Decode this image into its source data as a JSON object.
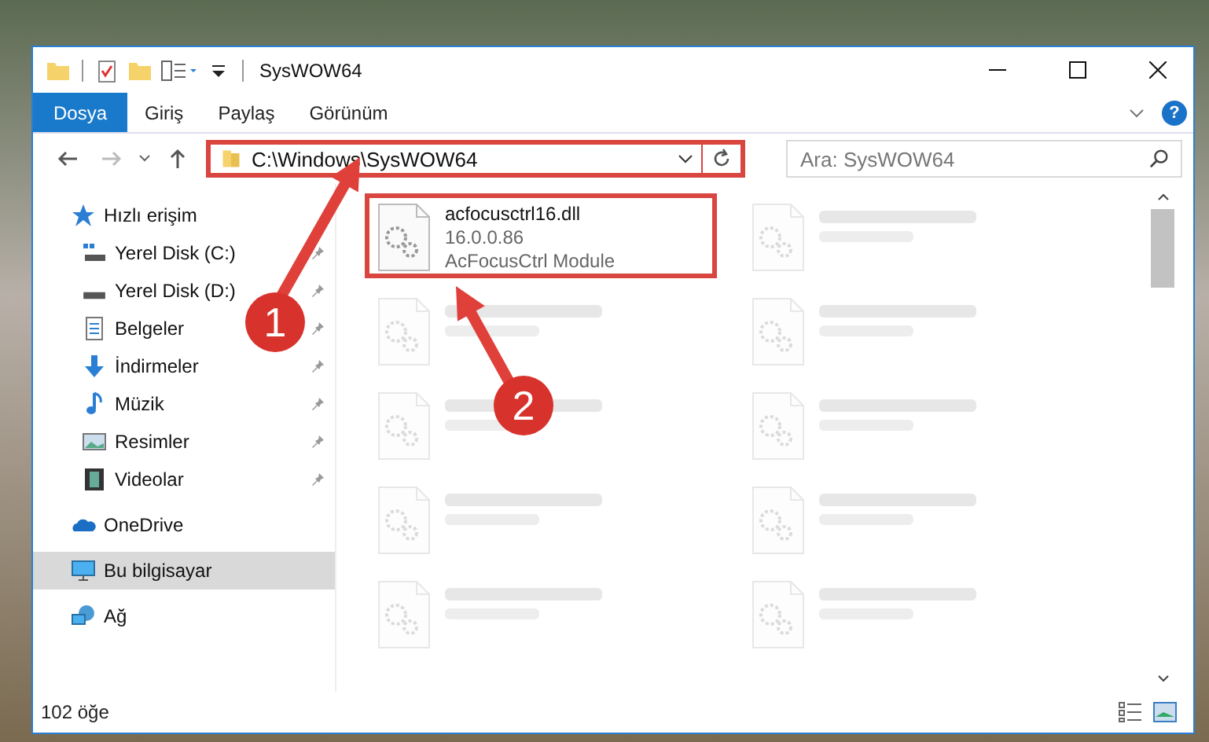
{
  "window": {
    "title": "SysWOW64"
  },
  "ribbon_tabs": [
    {
      "label": "Dosya",
      "kind": "file"
    },
    {
      "label": "Giriş",
      "kind": "tab"
    },
    {
      "label": "Paylaş",
      "kind": "tab"
    },
    {
      "label": "Görünüm",
      "kind": "tab"
    }
  ],
  "help": "?",
  "address": {
    "path": "C:\\Windows\\SysWOW64",
    "annotated": true
  },
  "search": {
    "placeholder": "Ara: SysWOW64"
  },
  "sidebar": {
    "items": [
      {
        "label": "Hızlı erişim",
        "kind": "star",
        "selected": false,
        "children": [
          {
            "label": "Yerel Disk (C:)",
            "kind": "drive-win",
            "pinned": true,
            "selected": false
          },
          {
            "label": "Yerel Disk (D:)",
            "kind": "drive",
            "pinned": true,
            "selected": false
          },
          {
            "label": "Belgeler",
            "kind": "document",
            "pinned": true,
            "selected": false
          },
          {
            "label": "İndirmeler",
            "kind": "download",
            "pinned": true,
            "selected": false
          },
          {
            "label": "Müzik",
            "kind": "music",
            "pinned": true,
            "selected": false
          },
          {
            "label": "Resimler",
            "kind": "pictures",
            "pinned": true,
            "selected": false
          },
          {
            "label": "Videolar",
            "kind": "video",
            "pinned": true,
            "selected": false
          }
        ]
      },
      {
        "label": "OneDrive",
        "kind": "cloud",
        "selected": false
      },
      {
        "label": "Bu bilgisayar",
        "kind": "computer",
        "selected": true
      },
      {
        "label": "Ağ",
        "kind": "network",
        "selected": false
      }
    ]
  },
  "files": [
    {
      "name": "acfocusctrl16.dll",
      "version": "16.0.0.86",
      "description": "AcFocusCtrl Module",
      "blurred": false,
      "annotated": true
    },
    {
      "blurred": true,
      "annotated": false
    },
    {
      "blurred": true,
      "annotated": false
    },
    {
      "blurred": true,
      "annotated": false
    },
    {
      "blurred": true,
      "annotated": false
    },
    {
      "blurred": true,
      "annotated": false
    },
    {
      "blurred": true,
      "annotated": false
    },
    {
      "blurred": true,
      "annotated": false
    },
    {
      "blurred": true,
      "annotated": false
    },
    {
      "blurred": true,
      "annotated": false
    }
  ],
  "status_bar": {
    "count": "102 öğe"
  },
  "annotations": [
    {
      "number": "1"
    },
    {
      "number": "2"
    }
  ]
}
